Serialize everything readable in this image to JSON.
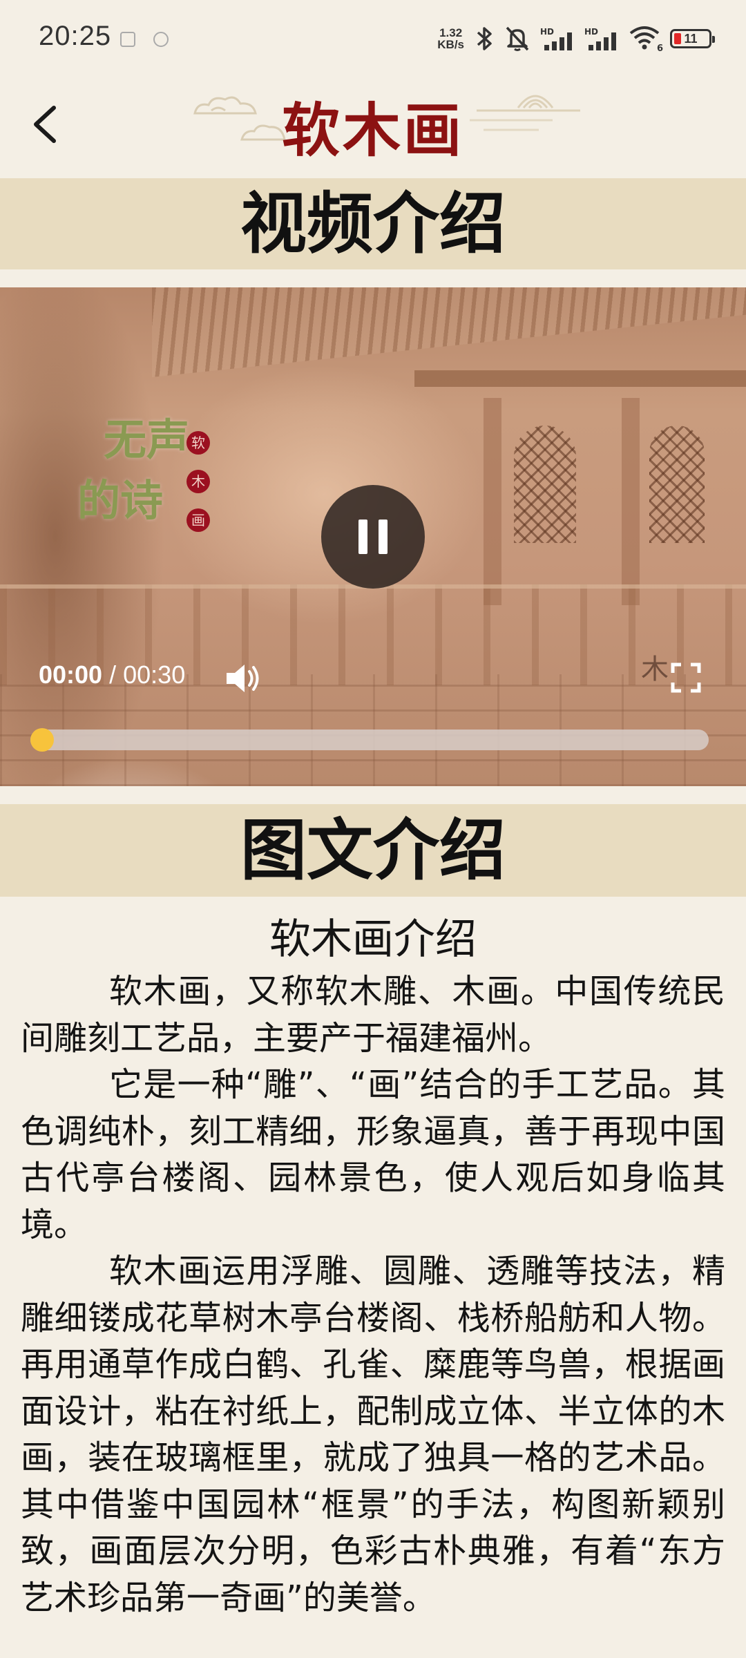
{
  "status_bar": {
    "time": "20:25",
    "net_speed_value": "1.32",
    "net_speed_unit": "KB/s",
    "signal_1_label": "HD",
    "signal_2_label": "HD",
    "wifi_label": "6",
    "battery_level": "11",
    "battery_color": "#e02828"
  },
  "header": {
    "title": "软木画",
    "title_color": "#8c1212"
  },
  "sections": {
    "video_title": "视频介绍",
    "text_title": "图文介绍"
  },
  "video": {
    "poem_line_1": "无声",
    "poem_line_2": "的诗",
    "seal_chars": [
      "软",
      "木",
      "画"
    ],
    "watermark": "木",
    "current_time": "00:00",
    "time_separator": "/",
    "duration": "00:30",
    "progress_fraction": 0.0,
    "state": "playing",
    "progress_color": "#f7c33c"
  },
  "article": {
    "title": "软木画介绍",
    "paragraphs": [
      "软木画，又称软木雕、木画。中国传统民间雕刻工艺品，主要产于福建福州。",
      "它是一种“雕”、“画”结合的手工艺品。其色调纯朴，刻工精细，形象逼真，善于再现中国古代亭台楼阁、园林景色，使人观后如身临其境。",
      "软木画运用浮雕、圆雕、透雕等技法，精雕细镂成花草树木亭台楼阁、栈桥船舫和人物。再用通草作成白鹤、孔雀、糜鹿等鸟兽，根据画面设计，粘在衬纸上，配制成立体、半立体的木画，装在玻璃框里，就成了独具一格的艺术品。其中借鉴中国园林“框景”的手法，构图新颖别致，画面层次分明，色彩古朴典雅，有着“东方艺术珍品第一奇画”的美誉。"
    ]
  }
}
